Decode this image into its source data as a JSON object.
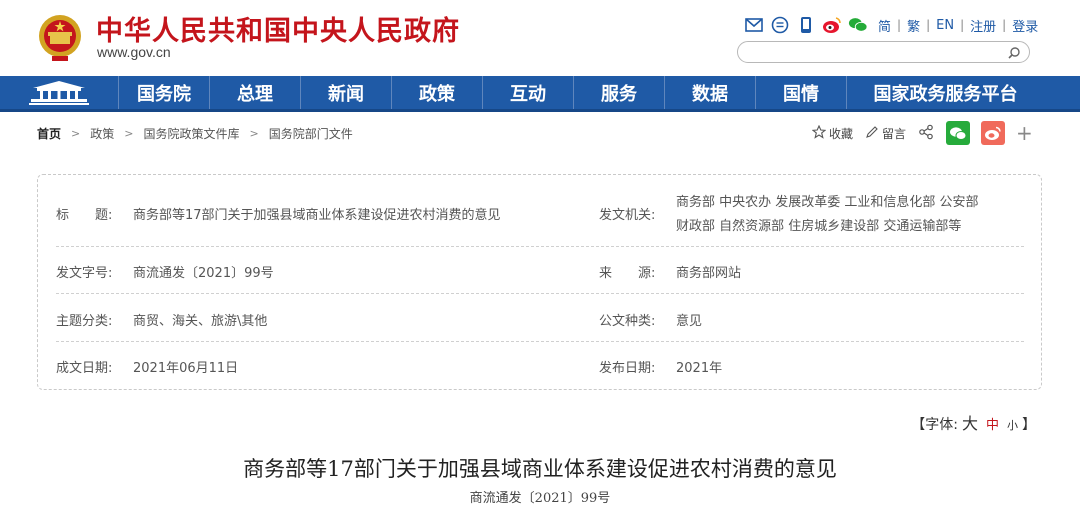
{
  "header": {
    "site_title": "中华人民共和国中央人民政府",
    "site_url": "www.gov.cn",
    "lang_links": [
      "简",
      "繁",
      "EN"
    ],
    "register": "注册",
    "login": "登录",
    "search_placeholder": ""
  },
  "nav": {
    "items": [
      "国务院",
      "总理",
      "新闻",
      "政策",
      "互动",
      "服务",
      "数据",
      "国情",
      "国家政务服务平台"
    ]
  },
  "breadcrumb": [
    "首页",
    "政策",
    "国务院政策文件库",
    "国务院部门文件"
  ],
  "actions": {
    "favorite": "收藏",
    "comment": "留言"
  },
  "info": {
    "title_label": "标　　题:",
    "title_value": "商务部等17部门关于加强县域商业体系建设促进农村消费的意见",
    "issuer_label": "发文机关:",
    "issuer_line1": "商务部 中央农办 发展改革委 工业和信息化部 公安部",
    "issuer_line2": "财政部 自然资源部 住房城乡建设部 交通运输部等",
    "docno_label": "发文字号:",
    "docno_value": "商流通发〔2021〕99号",
    "source_label": "来　　源:",
    "source_value": "商务部网站",
    "topic_label": "主题分类:",
    "topic_value": "商贸、海关、旅游\\其他",
    "doctype_label": "公文种类:",
    "doctype_value": "意见",
    "written_label": "成文日期:",
    "written_value": "2021年06月11日",
    "published_label": "发布日期:",
    "published_value": "2021年"
  },
  "font_switch": {
    "prefix": "【字体:",
    "big": "大",
    "mid": "中",
    "small": "小",
    "suffix": "】"
  },
  "article": {
    "title": "商务部等17部门关于加强县域商业体系建设促进农村消费的意见",
    "doc_number": "商流通发〔2021〕99号"
  },
  "colors": {
    "brand_red": "#c4151c",
    "nav_blue": "#1f5aa6"
  }
}
